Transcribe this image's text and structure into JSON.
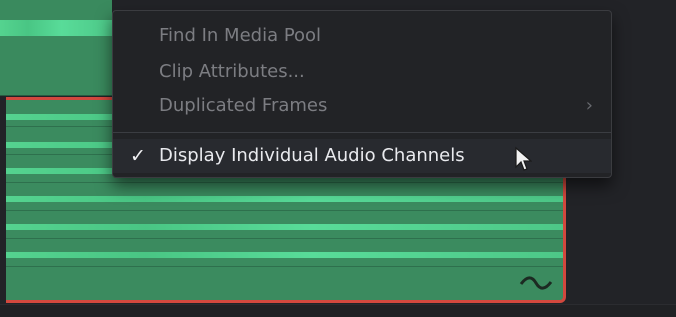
{
  "context_menu": {
    "items": [
      {
        "label": "Find In Media Pool",
        "enabled": false
      },
      {
        "label": "Clip Attributes...",
        "enabled": false
      },
      {
        "label": "Duplicated Frames",
        "enabled": false,
        "has_submenu": true,
        "submenu_icon": "chevron-right-icon"
      },
      {
        "label": "Display Individual Audio Channels",
        "enabled": true,
        "checked": true,
        "check_icon": "checkmark-icon"
      }
    ]
  },
  "colors": {
    "clip_fill": "#3b8b5f",
    "waveform": "#56d792",
    "selection_border": "#d2483e",
    "menu_bg": "#222326"
  }
}
